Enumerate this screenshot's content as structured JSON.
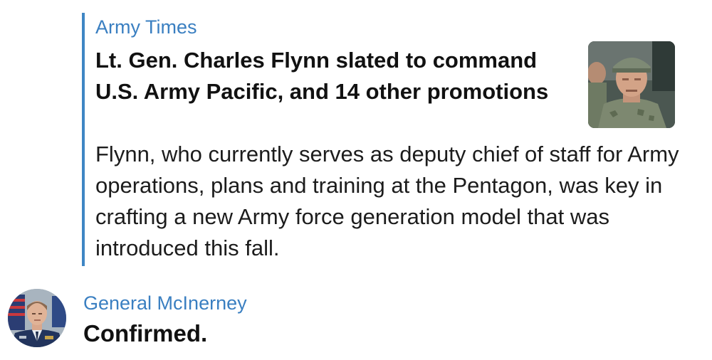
{
  "link_preview": {
    "source": "Army Times",
    "title": "Lt. Gen. Charles Flynn slated to command U.S. Army Pacific, and 14 other promotions",
    "description": "Flynn, who currently serves as deputy chief of staff for Army operations, plans and training at the Pentagon, was key in crafting a new Army force generation model that was introduced this fall.",
    "accent_color": "#3f86c4"
  },
  "reply": {
    "author": "General McInerney",
    "text": "Confirmed.",
    "author_color": "#3a7fc1"
  }
}
